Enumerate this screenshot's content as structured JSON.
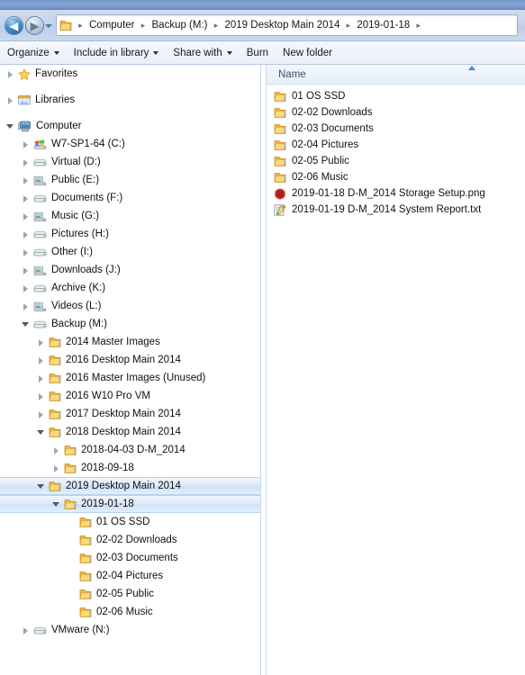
{
  "window": {
    "title": "2019-01-18"
  },
  "nav": {
    "back_label": "←",
    "forward_label": "→",
    "history_label": "Recent pages",
    "breadcrumbs": [
      "Computer",
      "Backup (M:)",
      "2019 Desktop Main 2014",
      "2019-01-18"
    ],
    "separator": "▸"
  },
  "toolbar": {
    "items": [
      {
        "label": "Organize",
        "caret": true
      },
      {
        "label": "Include in library",
        "caret": true
      },
      {
        "label": "Share with",
        "caret": true
      },
      {
        "label": "Burn",
        "caret": false
      },
      {
        "label": "New folder",
        "caret": false
      }
    ]
  },
  "filelist": {
    "column_header": "Name",
    "sort_direction": "ascending",
    "rows": [
      {
        "name": "01 OS SSD",
        "icon": "folder-icon"
      },
      {
        "name": "02-02 Downloads",
        "icon": "folder-icon"
      },
      {
        "name": "02-03 Documents",
        "icon": "folder-icon"
      },
      {
        "name": "02-04 Pictures",
        "icon": "folder-icon"
      },
      {
        "name": "02-05 Public",
        "icon": "folder-icon"
      },
      {
        "name": "02-06 Music",
        "icon": "folder-icon"
      },
      {
        "name": "2019-01-18 D-M_2014 Storage Setup.png",
        "icon": "png-image-icon"
      },
      {
        "name": "2019-01-19 D-M_2014 System Report.txt",
        "icon": "text-document-icon"
      }
    ]
  },
  "tree": {
    "nodes": [
      {
        "label": "Favorites",
        "icon": "star-icon",
        "indent": 0,
        "state": "collapsed",
        "selected": false,
        "gap_after": true
      },
      {
        "label": "Libraries",
        "icon": "libraries-icon",
        "indent": 0,
        "state": "collapsed",
        "selected": false,
        "gap_after": true
      },
      {
        "label": "Computer",
        "icon": "computer-icon",
        "indent": 0,
        "state": "expanded",
        "selected": false
      },
      {
        "label": "W7-SP1-64 (C:)",
        "icon": "system-drive-icon",
        "indent": 1,
        "state": "collapsed",
        "selected": false
      },
      {
        "label": "Virtual (D:)",
        "icon": "drive-icon",
        "indent": 1,
        "state": "collapsed",
        "selected": false
      },
      {
        "label": "Public (E:)",
        "icon": "network-drive-icon",
        "indent": 1,
        "state": "collapsed",
        "selected": false
      },
      {
        "label": "Documents (F:)",
        "icon": "drive-icon",
        "indent": 1,
        "state": "collapsed",
        "selected": false
      },
      {
        "label": "Music (G:)",
        "icon": "network-drive-icon",
        "indent": 1,
        "state": "collapsed",
        "selected": false
      },
      {
        "label": "Pictures (H:)",
        "icon": "drive-icon",
        "indent": 1,
        "state": "collapsed",
        "selected": false
      },
      {
        "label": "Other (I:)",
        "icon": "drive-icon",
        "indent": 1,
        "state": "collapsed",
        "selected": false
      },
      {
        "label": "Downloads (J:)",
        "icon": "network-drive-icon",
        "indent": 1,
        "state": "collapsed",
        "selected": false
      },
      {
        "label": "Archive (K:)",
        "icon": "drive-icon",
        "indent": 1,
        "state": "collapsed",
        "selected": false
      },
      {
        "label": "Videos (L:)",
        "icon": "network-drive-icon",
        "indent": 1,
        "state": "collapsed",
        "selected": false
      },
      {
        "label": "Backup (M:)",
        "icon": "drive-icon",
        "indent": 1,
        "state": "expanded",
        "selected": false
      },
      {
        "label": "2014 Master Images",
        "icon": "folder-icon",
        "indent": 2,
        "state": "collapsed",
        "selected": false
      },
      {
        "label": "2016 Desktop Main 2014",
        "icon": "folder-icon",
        "indent": 2,
        "state": "collapsed",
        "selected": false
      },
      {
        "label": "2016 Master Images (Unused)",
        "icon": "folder-icon",
        "indent": 2,
        "state": "collapsed",
        "selected": false
      },
      {
        "label": "2016 W10 Pro VM",
        "icon": "folder-icon",
        "indent": 2,
        "state": "collapsed",
        "selected": false
      },
      {
        "label": "2017 Desktop Main 2014",
        "icon": "folder-icon",
        "indent": 2,
        "state": "collapsed",
        "selected": false
      },
      {
        "label": "2018 Desktop Main 2014",
        "icon": "folder-icon",
        "indent": 2,
        "state": "expanded",
        "selected": false
      },
      {
        "label": "2018-04-03 D-M_2014",
        "icon": "folder-icon",
        "indent": 3,
        "state": "collapsed",
        "selected": false
      },
      {
        "label": "2018-09-18",
        "icon": "folder-icon",
        "indent": 3,
        "state": "collapsed",
        "selected": false
      },
      {
        "label": "2019 Desktop Main 2014",
        "icon": "folder-icon",
        "indent": 2,
        "state": "expanded",
        "selected": true
      },
      {
        "label": "2019-01-18",
        "icon": "folder-icon",
        "indent": 3,
        "state": "expanded",
        "selected": true
      },
      {
        "label": "01 OS SSD",
        "icon": "folder-icon",
        "indent": 4,
        "state": "leaf",
        "selected": false
      },
      {
        "label": "02-02 Downloads",
        "icon": "folder-icon",
        "indent": 4,
        "state": "leaf",
        "selected": false
      },
      {
        "label": "02-03 Documents",
        "icon": "folder-icon",
        "indent": 4,
        "state": "leaf",
        "selected": false
      },
      {
        "label": "02-04 Pictures",
        "icon": "folder-icon",
        "indent": 4,
        "state": "leaf",
        "selected": false
      },
      {
        "label": "02-05 Public",
        "icon": "folder-icon",
        "indent": 4,
        "state": "leaf",
        "selected": false
      },
      {
        "label": "02-06 Music",
        "icon": "folder-icon",
        "indent": 4,
        "state": "leaf",
        "selected": false
      },
      {
        "label": "VMware (N:)",
        "icon": "drive-icon",
        "indent": 1,
        "state": "collapsed",
        "selected": false
      }
    ]
  },
  "colors": {
    "selection_border": "#b7d4ef",
    "folder_yellow": "#f5c04a",
    "accent_blue": "#3d8fd0",
    "header_text": "#36536e",
    "png_icon_red": "#cc2222"
  }
}
